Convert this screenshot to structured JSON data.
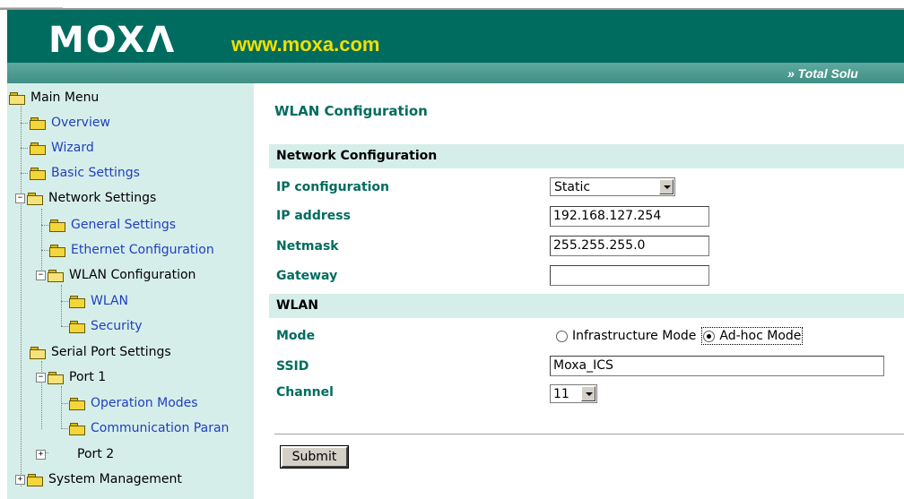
{
  "header": {
    "logo": "MOXΛ",
    "site": "www.moxa.com",
    "tagline": "»  Total Solu"
  },
  "sidebar": {
    "items": [
      {
        "label": "Main Menu"
      },
      {
        "label": "Overview"
      },
      {
        "label": "Wizard"
      },
      {
        "label": "Basic Settings"
      },
      {
        "label": "Network Settings"
      },
      {
        "label": "General Settings"
      },
      {
        "label": "Ethernet Configuration"
      },
      {
        "label": "WLAN Configuration"
      },
      {
        "label": "WLAN"
      },
      {
        "label": "Security"
      },
      {
        "label": "Serial Port Settings"
      },
      {
        "label": "Port 1"
      },
      {
        "label": "Operation Modes"
      },
      {
        "label": "Communication Paran"
      },
      {
        "label": "Port 2"
      },
      {
        "label": "System Management"
      }
    ]
  },
  "main": {
    "title": "WLAN Configuration",
    "network_section": "Network Configuration",
    "ip_config_label": "IP configuration",
    "ip_config_value": "Static",
    "ip_address_label": "IP address",
    "ip_address_value": "192.168.127.254",
    "netmask_label": "Netmask",
    "netmask_value": "255.255.255.0",
    "gateway_label": "Gateway",
    "gateway_value": "",
    "wlan_section": "WLAN",
    "mode_label": "Mode",
    "mode_options": [
      "Infrastructure Mode",
      "Ad-hoc Mode"
    ],
    "mode_selected": "Ad-hoc Mode",
    "ssid_label": "SSID",
    "ssid_value": "Moxa_ICS",
    "channel_label": "Channel",
    "channel_value": "11",
    "submit_label": "Submit"
  },
  "colors": {
    "header_bg": "#006c5f",
    "sidebar_bg": "#d6eee9",
    "label_text": "#006c5f",
    "link_text": "#1f3fbf",
    "site_text": "#f2e000"
  }
}
